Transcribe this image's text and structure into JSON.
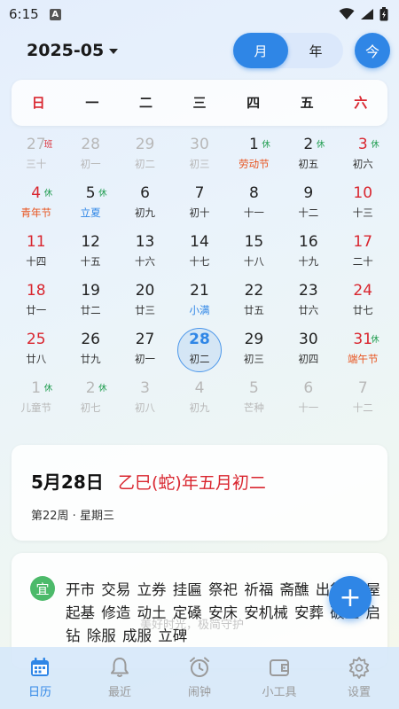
{
  "status_bar": {
    "time": "6:15",
    "notif_letter": "A"
  },
  "header": {
    "month_label": "2025-05",
    "view_tabs": [
      {
        "label": "月",
        "active": true
      },
      {
        "label": "年",
        "active": false
      }
    ],
    "today_label": "今"
  },
  "weekdays": [
    "日",
    "一",
    "二",
    "三",
    "四",
    "五",
    "六"
  ],
  "calendar": [
    [
      {
        "day": "27",
        "lunar": "三十",
        "badge": "班",
        "badge_type": "work",
        "other": true
      },
      {
        "day": "28",
        "lunar": "初一",
        "other": true
      },
      {
        "day": "29",
        "lunar": "初二",
        "other": true
      },
      {
        "day": "30",
        "lunar": "初三",
        "other": true
      },
      {
        "day": "1",
        "lunar": "劳动节",
        "lunar_style": "festival",
        "badge": "休",
        "badge_type": "rest"
      },
      {
        "day": "2",
        "lunar": "初五",
        "badge": "休",
        "badge_type": "rest"
      },
      {
        "day": "3",
        "lunar": "初六",
        "badge": "休",
        "badge_type": "rest"
      }
    ],
    [
      {
        "day": "4",
        "lunar": "青年节",
        "lunar_style": "festival",
        "badge": "休",
        "badge_type": "rest"
      },
      {
        "day": "5",
        "lunar": "立夏",
        "lunar_style": "term",
        "badge": "休",
        "badge_type": "rest"
      },
      {
        "day": "6",
        "lunar": "初九"
      },
      {
        "day": "7",
        "lunar": "初十"
      },
      {
        "day": "8",
        "lunar": "十一"
      },
      {
        "day": "9",
        "lunar": "十二"
      },
      {
        "day": "10",
        "lunar": "十三"
      }
    ],
    [
      {
        "day": "11",
        "lunar": "十四"
      },
      {
        "day": "12",
        "lunar": "十五"
      },
      {
        "day": "13",
        "lunar": "十六"
      },
      {
        "day": "14",
        "lunar": "十七"
      },
      {
        "day": "15",
        "lunar": "十八"
      },
      {
        "day": "16",
        "lunar": "十九"
      },
      {
        "day": "17",
        "lunar": "二十"
      }
    ],
    [
      {
        "day": "18",
        "lunar": "廿一"
      },
      {
        "day": "19",
        "lunar": "廿二"
      },
      {
        "day": "20",
        "lunar": "廿三"
      },
      {
        "day": "21",
        "lunar": "小满",
        "lunar_style": "term"
      },
      {
        "day": "22",
        "lunar": "廿五"
      },
      {
        "day": "23",
        "lunar": "廿六"
      },
      {
        "day": "24",
        "lunar": "廿七"
      }
    ],
    [
      {
        "day": "25",
        "lunar": "廿八"
      },
      {
        "day": "26",
        "lunar": "廿九"
      },
      {
        "day": "27",
        "lunar": "初一"
      },
      {
        "day": "28",
        "lunar": "初二",
        "today": true
      },
      {
        "day": "29",
        "lunar": "初三"
      },
      {
        "day": "30",
        "lunar": "初四"
      },
      {
        "day": "31",
        "lunar": "端午节",
        "lunar_style": "festival",
        "badge": "休",
        "badge_type": "rest"
      }
    ],
    [
      {
        "day": "1",
        "lunar": "儿童节",
        "badge": "休",
        "badge_type": "rest",
        "other": true
      },
      {
        "day": "2",
        "lunar": "初七",
        "badge": "休",
        "badge_type": "rest",
        "other": true
      },
      {
        "day": "3",
        "lunar": "初八",
        "other": true
      },
      {
        "day": "4",
        "lunar": "初九",
        "other": true
      },
      {
        "day": "5",
        "lunar": "芒种",
        "lunar_style": "term",
        "other": true
      },
      {
        "day": "6",
        "lunar": "十一",
        "other": true
      },
      {
        "day": "7",
        "lunar": "十二",
        "other": true
      }
    ]
  ],
  "date_card": {
    "date": "5月28日",
    "ganzhi": "乙巳(蛇)年五月初二",
    "week_info": "第22周 · 星期三"
  },
  "almanac": {
    "yi_label": "宜",
    "yi_items": "开市 交易 立券 挂匾 祭祀 祈福 斋醮 出行 盖屋 起基 修造 动土 定磉 安床 安机械 安葬 破土 启钻 除服 成服 立碑",
    "ghost_text": "美好时光，极简守护"
  },
  "fab_label": "+",
  "tabbar": [
    {
      "label": "日历",
      "icon": "calendar-icon",
      "active": true
    },
    {
      "label": "最近",
      "icon": "bell-icon",
      "active": false
    },
    {
      "label": "闹钟",
      "icon": "alarm-clock-icon",
      "active": false
    },
    {
      "label": "小工具",
      "icon": "wallet-icon",
      "active": false
    },
    {
      "label": "设置",
      "icon": "gear-icon",
      "active": false
    }
  ],
  "colors": {
    "accent": "#2f86e6",
    "holiday_red": "#d9262f",
    "rest_green": "#1a9a4a",
    "festival_orange": "#e8541f"
  }
}
